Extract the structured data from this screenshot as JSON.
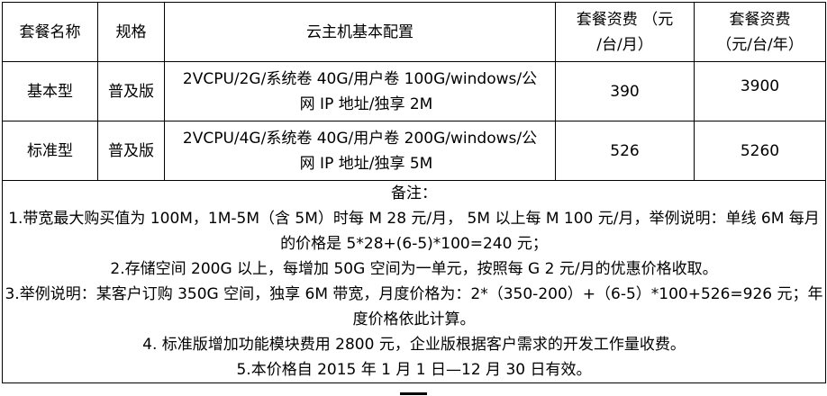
{
  "header": {
    "package_name": "套餐名称",
    "spec": "规格",
    "config": "云主机基本配置",
    "monthly_fee_line1": "套餐资费 （元",
    "monthly_fee_line2": "/台/月）",
    "yearly_fee_line1": "套餐资费",
    "yearly_fee_line2": "（元/台/年）"
  },
  "rows": [
    {
      "name": "基本型",
      "spec": "普及版",
      "config_line1": "2VCPU/2G/系统卷 40G/用户卷 100G/windows/公",
      "config_line2": "网 IP 地址/独享 2M",
      "monthly": "390",
      "yearly": "3900"
    },
    {
      "name": "标准型",
      "spec": "普及版",
      "config_line1": "2VCPU/4G/系统卷 40G/用户卷 200G/windows/公",
      "config_line2": "网 IP 地址/独享 5M",
      "monthly": "526",
      "yearly": "5260"
    }
  ],
  "notes": {
    "title": "备注：",
    "items": [
      "1.带宽最大购买值为 100M，1M-5M（含 5M）时每 M 28 元/月， 5M 以上每 M 100 元/月，举例说明：单线 6M 每月的价格是 5*28+(6-5)*100=240 元；",
      "2.存储空间 200G 以上，每增加 50G 空间为一单元，按照每 G 2 元/月的优惠价格收取。",
      "3.举例说明：某客户订购 350G 空间，独享 6M 带宽，月度价格为：2*（350-200）+（6-5）*100+526=926 元；年度价格依此计算。",
      "4. 标准版增加功能模块费用 2800 元，企业版根据客户需求的开发工作量收费。",
      "5.本价格自 2015 年 1 月 1 日—12 月 30 日有效。"
    ]
  }
}
